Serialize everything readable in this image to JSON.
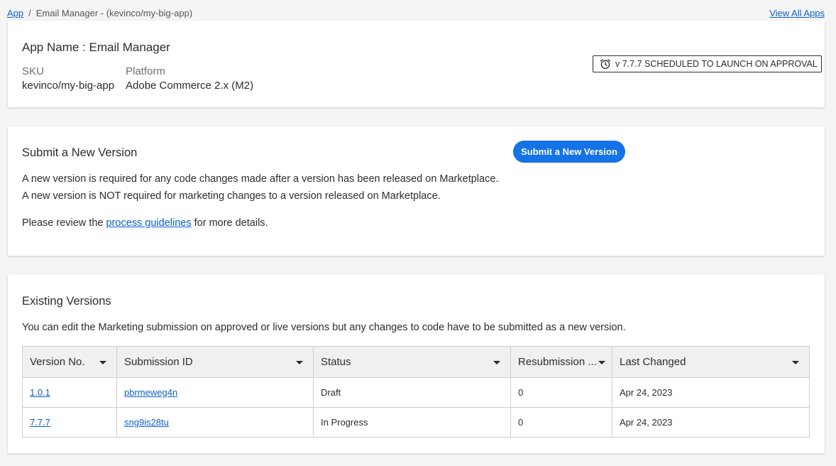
{
  "breadcrumb": {
    "root": "App",
    "separator": "/",
    "current": "Email Manager - (kevinco/my-big-app)",
    "view_all": "View All Apps"
  },
  "app_card": {
    "app_name": "App Name : Email Manager",
    "sku_label": "SKU",
    "sku_value": "kevinco/my-big-app",
    "platform_label": "Platform",
    "platform_value": "Adobe Commerce 2.x (M2)",
    "status_badge": "v 7.7.7 SCHEDULED TO LAUNCH ON APPROVAL",
    "status_icon": "alarm-clock-icon"
  },
  "submit_card": {
    "title": "Submit a New Version",
    "button_label": "Submit a New Version",
    "line1": "A new version is required for any code changes made after a version has been released on Marketplace.",
    "line2": "A new version is NOT required for marketing changes to a version released on Marketplace.",
    "review_prefix": "Please review the ",
    "review_link": "process guidelines",
    "review_suffix": " for more details."
  },
  "versions_card": {
    "title": "Existing Versions",
    "description": "You can edit the Marketing submission on approved or live versions but any changes to code have to be submitted as a new version.",
    "columns": [
      "Version No.",
      "Submission ID",
      "Status",
      "Resubmission ...",
      "Last Changed"
    ],
    "rows": [
      {
        "version": "1.0.1",
        "submission_id": "pbrmeweg4n",
        "status": "Draft",
        "resubmission": "0",
        "last_changed": "Apr 24, 2023"
      },
      {
        "version": "7.7.7",
        "submission_id": "sng9is28tu",
        "status": "In Progress",
        "resubmission": "0",
        "last_changed": "Apr 24, 2023"
      }
    ]
  },
  "colors": {
    "accent": "#1473e6",
    "link": "#0b5fcc",
    "background": "#f5f5f5"
  }
}
